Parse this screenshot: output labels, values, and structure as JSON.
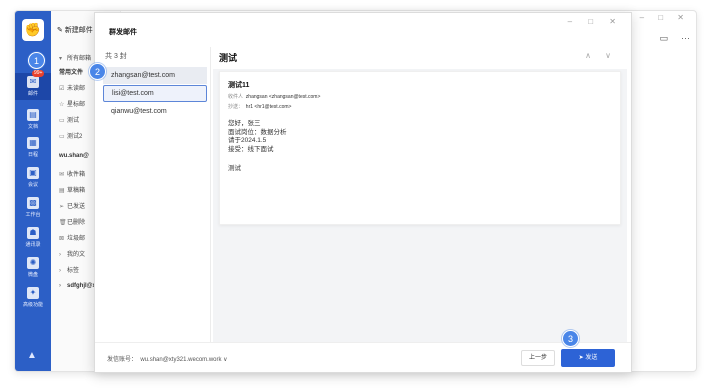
{
  "bg": {
    "window_controls": "– □ ✕",
    "compose_label": "新建邮件",
    "nav_all_mail": "所有邮箱",
    "nav_common": "常用文件",
    "nav_unread": "未读邮",
    "nav_starred": "星标邮",
    "nav_test": "测试",
    "nav_test2": "测试2",
    "account": "wu.shan@",
    "nav_inbox": "收件箱",
    "nav_draft": "草稿箱",
    "nav_sent": "已发送",
    "nav_deleted": "已删除",
    "nav_junk": "垃圾邮",
    "nav_mine": "我的文",
    "nav_tags": "标签",
    "account2": "sdfghjl@xi",
    "right_icon": "▭",
    "right_more": "···"
  },
  "rail": {
    "logo": "✊",
    "badge": "99+",
    "items": [
      {
        "label": "邮件",
        "icon": "✉"
      },
      {
        "label": "文档",
        "icon": "▤"
      },
      {
        "label": "日程",
        "icon": "▦"
      },
      {
        "label": "会议",
        "icon": "▣"
      },
      {
        "label": "工作台",
        "icon": "▩"
      },
      {
        "label": "通讯录",
        "icon": "☗"
      },
      {
        "label": "微盘",
        "icon": "✺"
      },
      {
        "label": "高级功能",
        "icon": "✦"
      }
    ],
    "bottom_icon": "▲"
  },
  "dialog": {
    "title": "群发邮件",
    "controls": "– □ ✕",
    "recipient_count": "共 3 封",
    "recipients": [
      "zhangsan@test.com",
      "lisi@test.com",
      "qianwu@test.com"
    ],
    "subject": "测试",
    "nav_arrows": "∧ ∨",
    "card": {
      "subject": "测试11",
      "to_label": "收件人",
      "to_value": "zhangsan <zhangsan@test.com>",
      "cc_label": "抄送：",
      "cc_value": "hr1 <hr1@test.com>",
      "body_lines": [
        "您好，张三",
        "面试岗位：数据分析",
        "请于2024.1.5",
        "接受：线下面试"
      ],
      "body_extra": "测试"
    },
    "footer": {
      "sender_label": "发信账号：",
      "sender_value": "wu.shan@xty321.wecom.work",
      "sender_chevron": "∨",
      "prev": "上一步",
      "send": "发送",
      "send_icon": "➤"
    }
  },
  "steps": [
    "1",
    "2",
    "3"
  ]
}
